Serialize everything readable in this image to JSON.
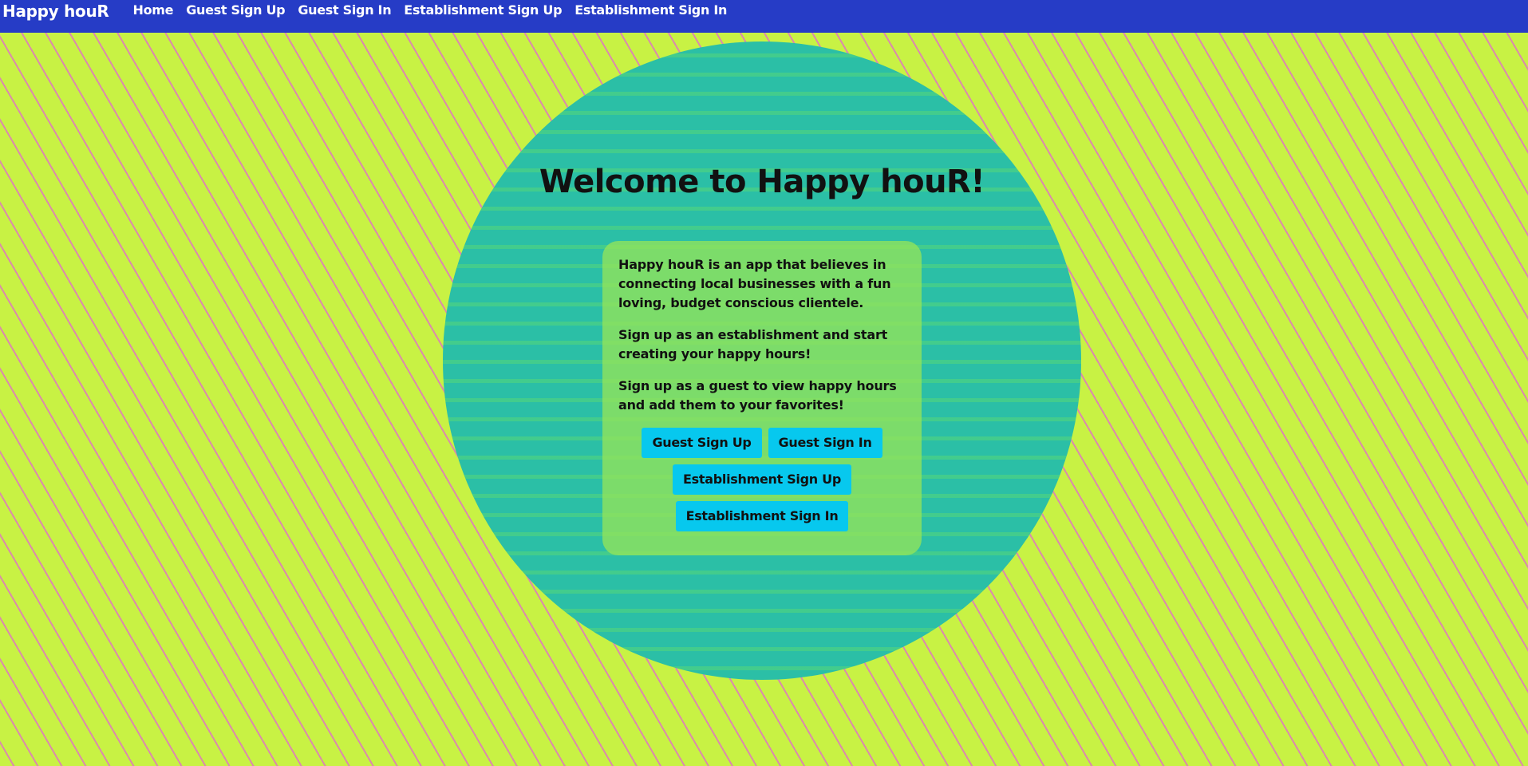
{
  "navbar": {
    "brand": "Happy houR",
    "links": [
      "Home",
      "Guest Sign Up",
      "Guest Sign In",
      "Establishment Sign Up",
      "Establishment Sign In"
    ]
  },
  "main": {
    "title": "Welcome to Happy houR!",
    "paragraphs": [
      "Happy houR is an app that believes in connecting local businesses with a fun loving, budget conscious clientele.",
      "Sign up as an establishment and start creating your happy hours!",
      "Sign up as a guest to view happy hours and add them to your favorites!"
    ],
    "buttons": {
      "guest_sign_up": "Guest Sign Up",
      "guest_sign_in": "Guest Sign In",
      "establishment_sign_up": "Establishment Sign Up",
      "establishment_sign_in": "Establishment Sign In"
    }
  },
  "colors": {
    "navbar": "#263cc6",
    "background": "#c8f244",
    "pattern": "#de78be",
    "circle": "#2bbfa6",
    "card": "#94e45a",
    "button": "#07c8ee"
  }
}
